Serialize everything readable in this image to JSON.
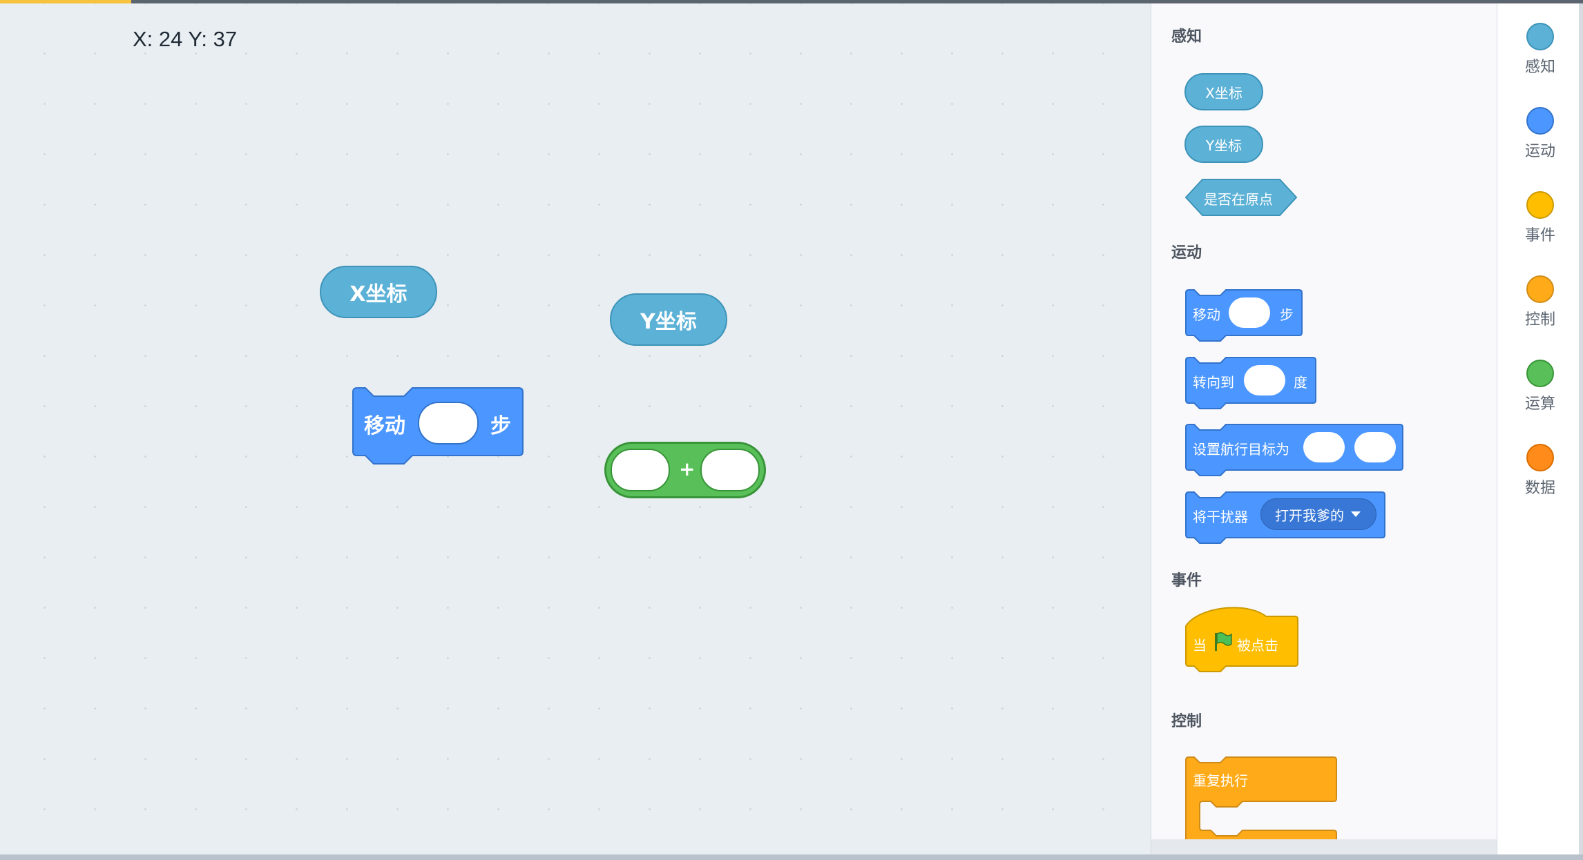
{
  "workspace": {
    "coordinates": "X: 24 Y: 37",
    "blocks": {
      "x_coord": "X坐标",
      "y_coord": "Y坐标",
      "move_label": "移动",
      "move_unit": "步",
      "plus": "+"
    }
  },
  "palette": {
    "sensing": {
      "title": "感知",
      "x_coord": "X坐标",
      "y_coord": "Y坐标",
      "at_origin": "是否在原点"
    },
    "motion": {
      "title": "运动",
      "move_label": "移动",
      "move_unit": "步",
      "turn_label": "转向到",
      "turn_unit": "度",
      "set_target_label": "设置航行目标为",
      "jammer_label": "将干扰器",
      "jammer_option": "打开我爹的"
    },
    "events": {
      "title": "事件",
      "when_label": "当",
      "clicked_label": "被点击"
    },
    "control": {
      "title": "控制",
      "repeat_label": "重复执行"
    }
  },
  "categories": [
    {
      "label": "感知",
      "color": "#5cb1d6"
    },
    {
      "label": "运动",
      "color": "#4c97ff"
    },
    {
      "label": "事件",
      "color": "#ffbf00"
    },
    {
      "label": "控制",
      "color": "#ffab19"
    },
    {
      "label": "运算",
      "color": "#59c059"
    },
    {
      "label": "数据",
      "color": "#ff8c1a"
    }
  ]
}
